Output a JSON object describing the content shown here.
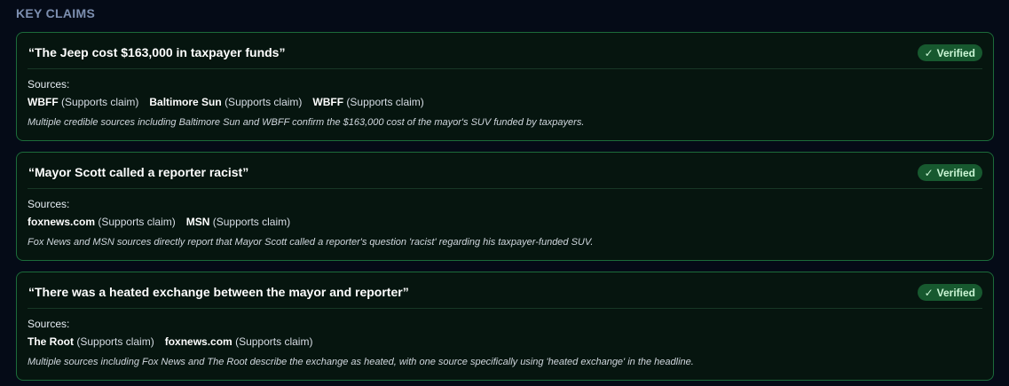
{
  "section": {
    "title": "KEY CLAIMS"
  },
  "colors": {
    "background": "#050b17",
    "card_background": "#06150f",
    "card_border": "#1c6b3a",
    "badge_background": "#17592f",
    "badge_text": "#c9f5d4",
    "section_title": "#7d8fb0"
  },
  "claims": [
    {
      "text": "“The Jeep cost $163,000 in taxpayer funds”",
      "badge": {
        "icon": "check-icon",
        "glyph": "✓",
        "label": "Verified"
      },
      "sources_label": "Sources:",
      "sources": [
        {
          "name": "WBFF",
          "stance": "(Supports claim)"
        },
        {
          "name": "Baltimore Sun",
          "stance": "(Supports claim)"
        },
        {
          "name": "WBFF",
          "stance": "(Supports claim)"
        }
      ],
      "explanation": "Multiple credible sources including Baltimore Sun and WBFF confirm the $163,000 cost of the mayor's SUV funded by taxpayers."
    },
    {
      "text": "“Mayor Scott called a reporter racist”",
      "badge": {
        "icon": "check-icon",
        "glyph": "✓",
        "label": "Verified"
      },
      "sources_label": "Sources:",
      "sources": [
        {
          "name": "foxnews.com",
          "stance": "(Supports claim)"
        },
        {
          "name": "MSN",
          "stance": "(Supports claim)"
        }
      ],
      "explanation": "Fox News and MSN sources directly report that Mayor Scott called a reporter's question 'racist' regarding his taxpayer-funded SUV."
    },
    {
      "text": "“There was a heated exchange between the mayor and reporter”",
      "badge": {
        "icon": "check-icon",
        "glyph": "✓",
        "label": "Verified"
      },
      "sources_label": "Sources:",
      "sources": [
        {
          "name": "The Root",
          "stance": "(Supports claim)"
        },
        {
          "name": "foxnews.com",
          "stance": "(Supports claim)"
        }
      ],
      "explanation": "Multiple sources including Fox News and The Root describe the exchange as heated, with one source specifically using 'heated exchange' in the headline."
    }
  ]
}
